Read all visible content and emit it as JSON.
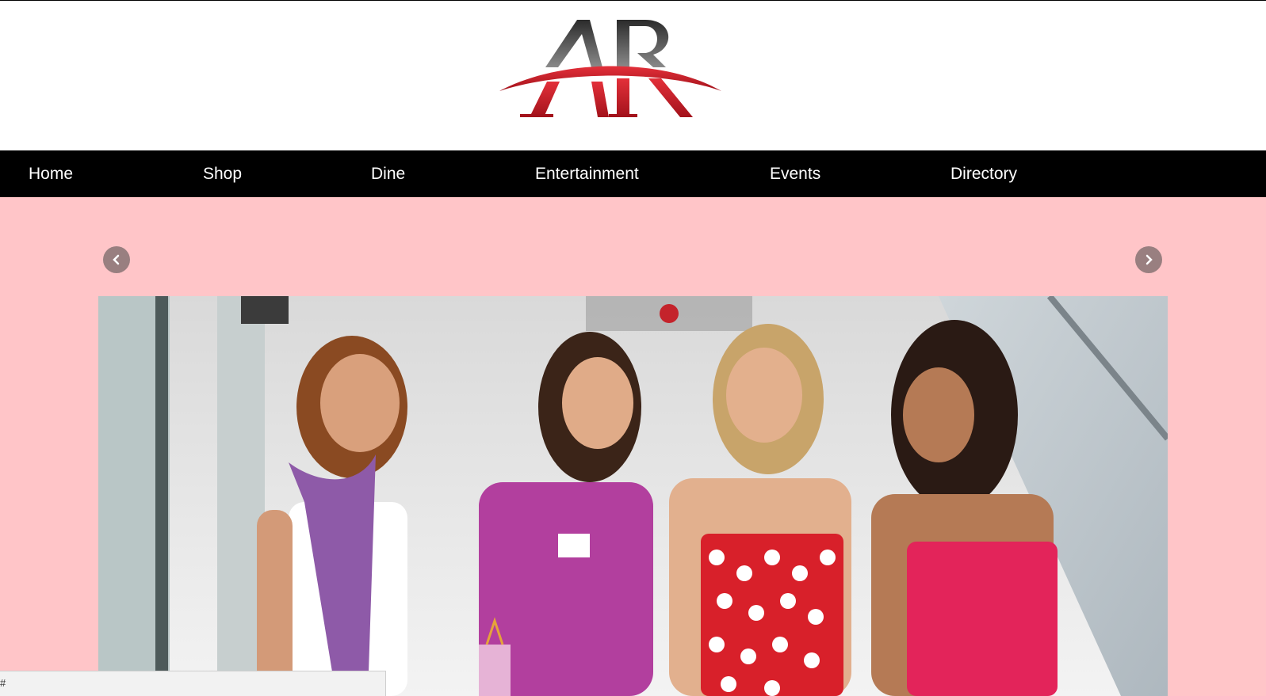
{
  "brand": {
    "logo_text": "AR"
  },
  "nav": {
    "items": [
      {
        "label": "Home"
      },
      {
        "label": "Shop"
      },
      {
        "label": "Dine"
      },
      {
        "label": "Entertainment"
      },
      {
        "label": "Events"
      },
      {
        "label": "Directory"
      }
    ]
  },
  "carousel": {
    "prev_icon": "chevron-left-icon",
    "next_icon": "chevron-right-icon"
  },
  "status_bar": {
    "url": "#"
  },
  "colors": {
    "nav_background": "#000000",
    "page_background": "#ffc5c8",
    "logo_red": "#d4202a",
    "logo_gray": "#555555"
  }
}
